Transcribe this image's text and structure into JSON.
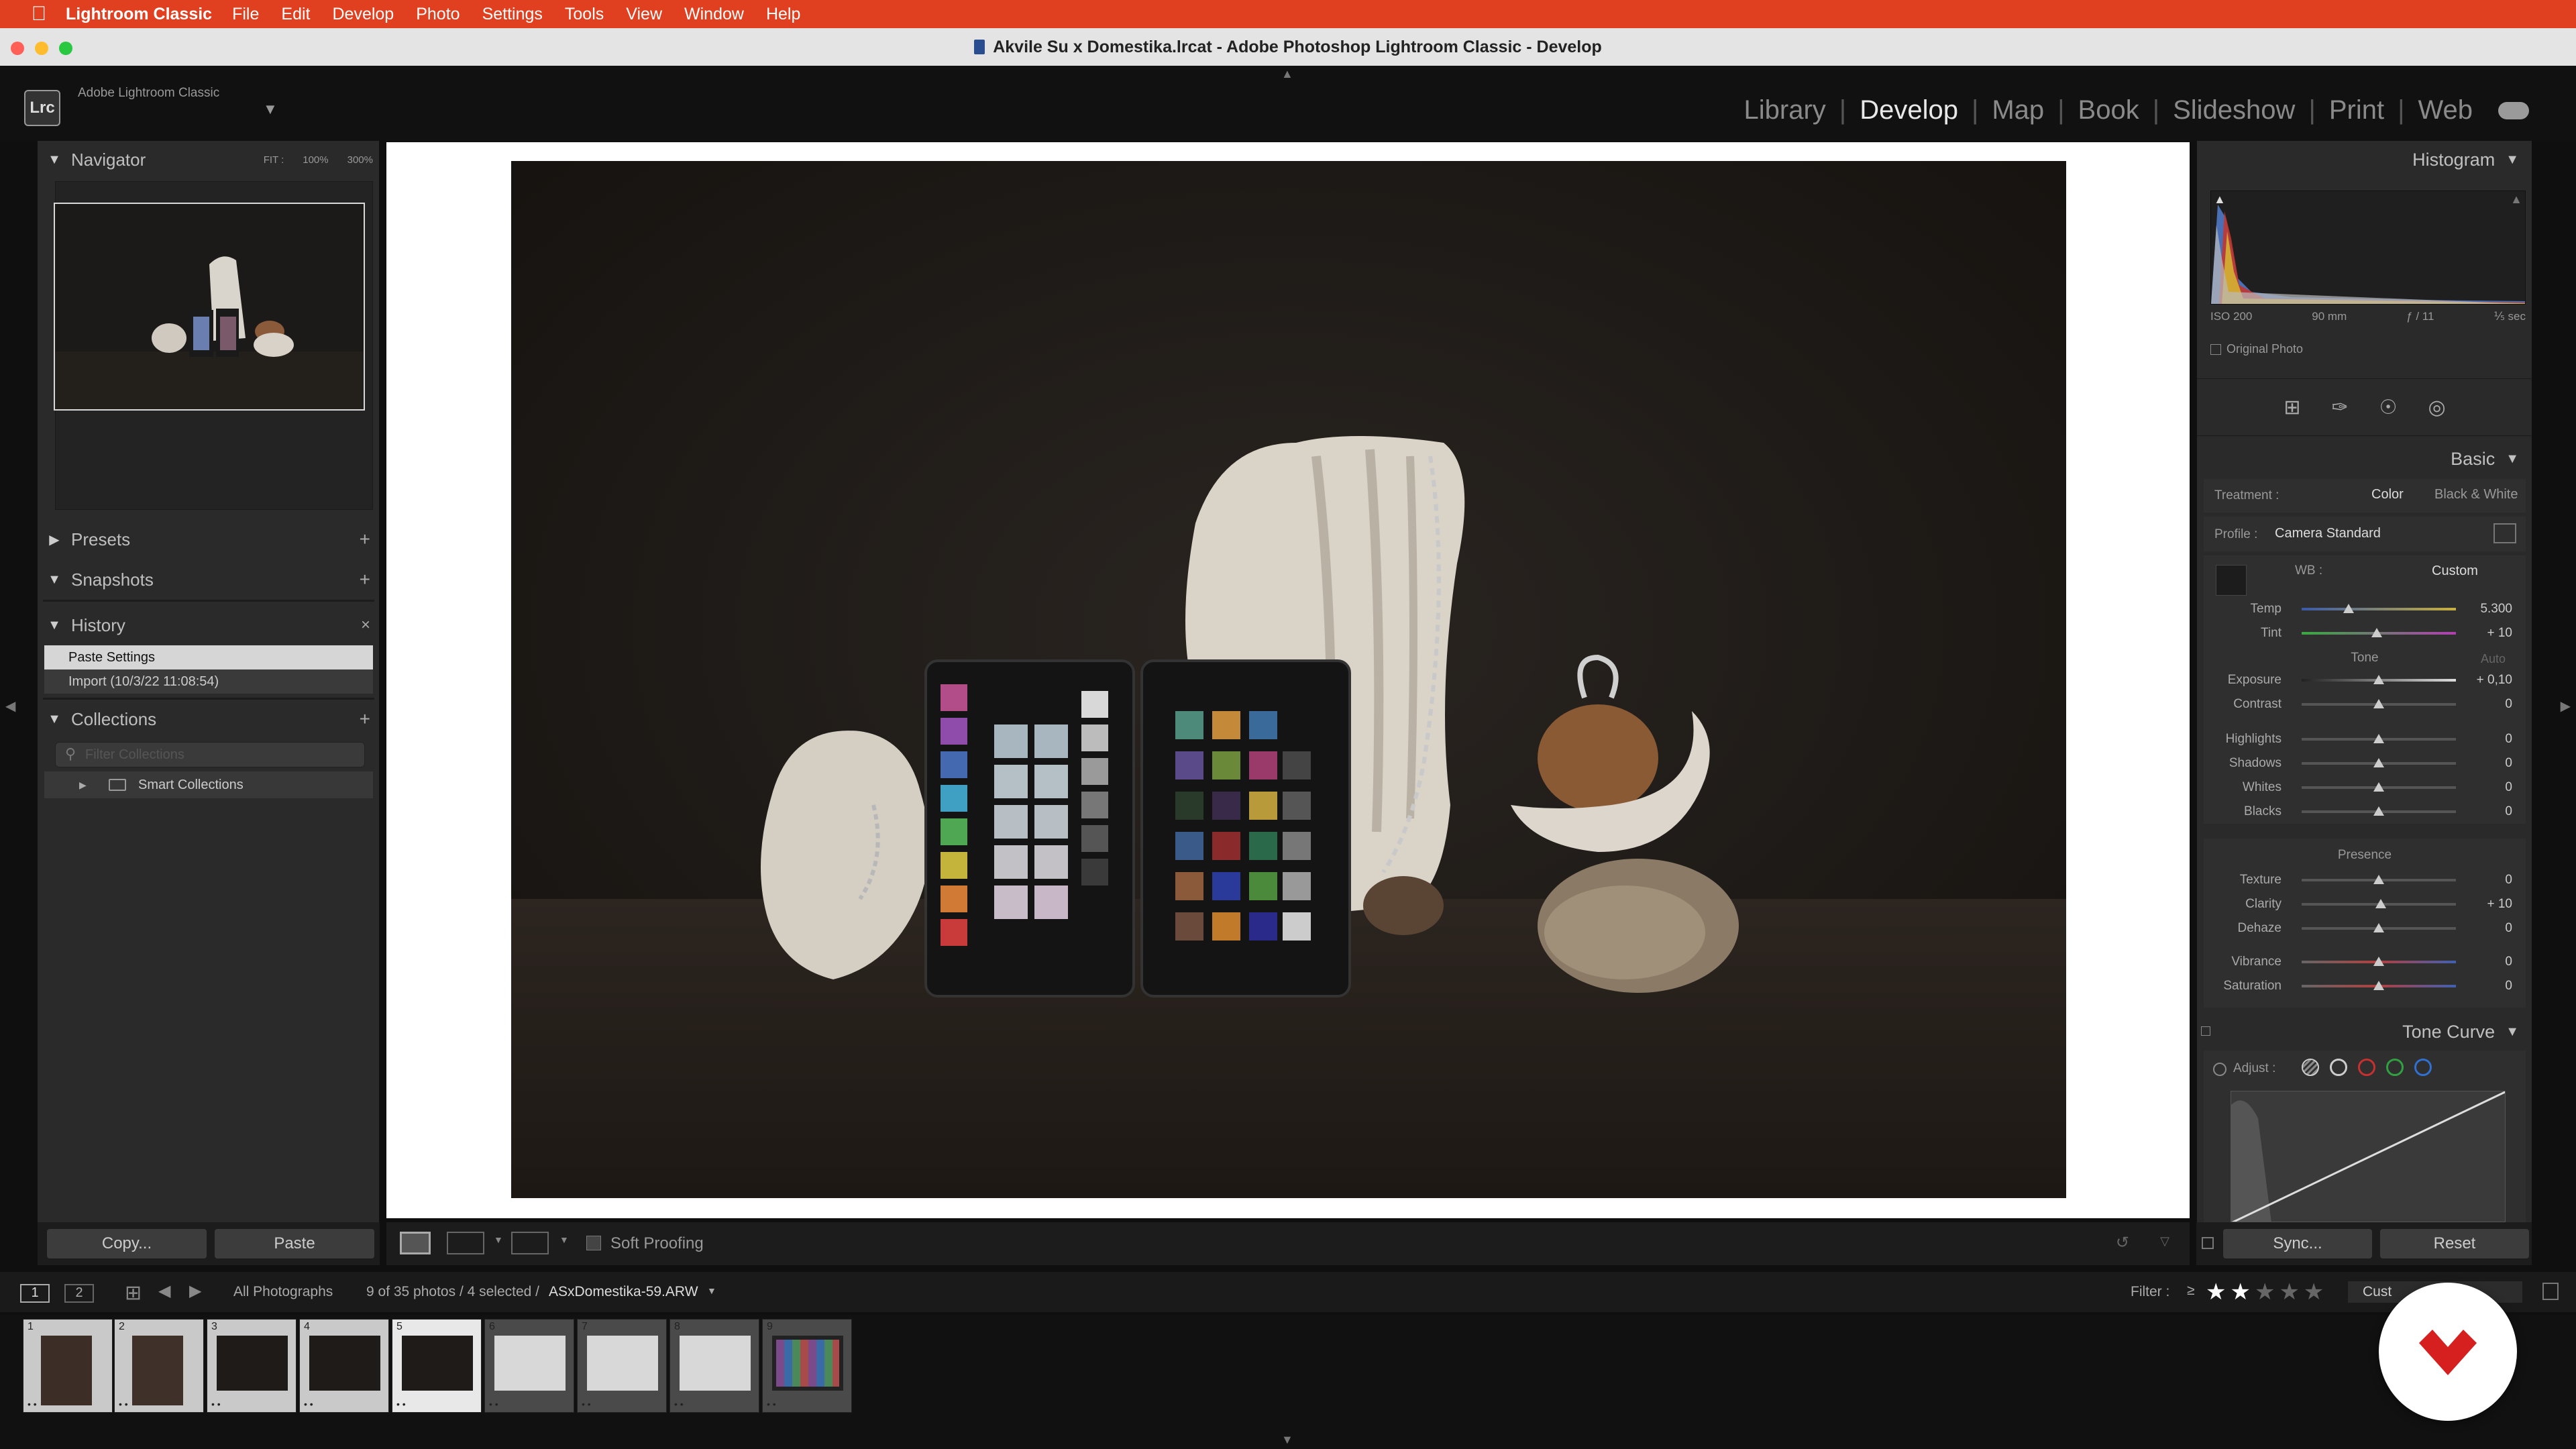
{
  "menubar": {
    "app_name": "Lightroom Classic",
    "items": [
      "File",
      "Edit",
      "Develop",
      "Photo",
      "Settings",
      "Tools",
      "View",
      "Window",
      "Help"
    ]
  },
  "window": {
    "title": "Akvile Su x Domestika.lrcat - Adobe Photoshop Lightroom Classic - Develop"
  },
  "identity": {
    "logo": "Lrc",
    "name": "Adobe Lightroom Classic"
  },
  "modules": [
    {
      "label": "Library"
    },
    {
      "label": "Develop"
    },
    {
      "label": "Map"
    },
    {
      "label": "Book"
    },
    {
      "label": "Slideshow"
    },
    {
      "label": "Print"
    },
    {
      "label": "Web"
    }
  ],
  "left": {
    "navigator": {
      "title": "Navigator",
      "zoom_fit": "FIT :",
      "zoom_100": "100%",
      "zoom_300": "300%"
    },
    "presets": "Presets",
    "snapshots": "Snapshots",
    "history": {
      "title": "History",
      "items": [
        "Paste Settings",
        "Import (10/3/22 11:08:54)"
      ]
    },
    "collections": {
      "title": "Collections",
      "filter_placeholder": "Filter Collections",
      "smart": "Smart Collections"
    },
    "copy_label": "Copy...",
    "paste_label": "Paste"
  },
  "toolbar": {
    "soft_proofing": "Soft Proofing"
  },
  "right": {
    "histogram": {
      "title": "Histogram",
      "iso": "ISO 200",
      "focal": "90 mm",
      "aperture": "ƒ / 11",
      "shutter": "⅕ sec",
      "original_photo": "Original Photo"
    },
    "basic": {
      "title": "Basic",
      "treatment_label": "Treatment :",
      "color": "Color",
      "bw": "Black & White",
      "profile_label": "Profile :",
      "profile_value": "Camera Standard",
      "wb_label": "WB :",
      "wb_value": "Custom",
      "tone_label": "Tone",
      "auto": "Auto",
      "presence_label": "Presence",
      "sliders": [
        {
          "label": "Temp",
          "value": "5.300"
        },
        {
          "label": "Tint",
          "value": "+ 10"
        },
        {
          "label": "Exposure",
          "value": "+ 0,10"
        },
        {
          "label": "Contrast",
          "value": "0"
        },
        {
          "label": "Highlights",
          "value": "0"
        },
        {
          "label": "Shadows",
          "value": "0"
        },
        {
          "label": "Whites",
          "value": "0"
        },
        {
          "label": "Blacks",
          "value": "0"
        },
        {
          "label": "Texture",
          "value": "0"
        },
        {
          "label": "Clarity",
          "value": "+ 10"
        },
        {
          "label": "Dehaze",
          "value": "0"
        },
        {
          "label": "Vibrance",
          "value": "0"
        },
        {
          "label": "Saturation",
          "value": "0"
        }
      ]
    },
    "tone_curve": {
      "title": "Tone Curve",
      "adjust": "Adjust :"
    },
    "sync_label": "Sync...",
    "reset_label": "Reset"
  },
  "filmstrip": {
    "page1": "1",
    "page2": "2",
    "source": "All Photographs",
    "count_prefix": "9 of 35 photos / 4 selected /",
    "filename": "ASxDomestika-59.ARW",
    "filter_label": "Filter :",
    "filter_op": "≥",
    "custom": "Cust",
    "cells": [
      {
        "num": "1",
        "stars": "• •"
      },
      {
        "num": "2",
        "stars": "• •"
      },
      {
        "num": "3",
        "stars": "• •"
      },
      {
        "num": "4",
        "stars": "• •"
      },
      {
        "num": "5",
        "stars": "• •"
      },
      {
        "num": "6",
        "stars": "• •"
      },
      {
        "num": "7",
        "stars": "• •"
      },
      {
        "num": "8",
        "stars": "• •"
      },
      {
        "num": "9",
        "stars": "• •"
      }
    ]
  }
}
